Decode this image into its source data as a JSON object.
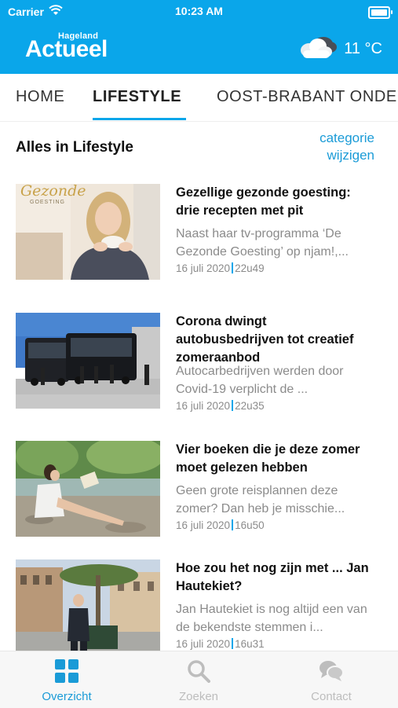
{
  "status_bar": {
    "carrier": "Carrier",
    "time": "10:23 AM"
  },
  "header": {
    "logo_superscript": "Hageland",
    "logo_main": "Actueel",
    "weather_icon": "cloud-icon",
    "temperature": "11 °C"
  },
  "tabs": [
    {
      "label": "HOME",
      "active": false
    },
    {
      "label": "LIFESTYLE",
      "active": true
    },
    {
      "label": "OOST-BRABANT ONDERNEMEN",
      "active": false
    }
  ],
  "section": {
    "title": "Alles in Lifestyle",
    "change_link_line1": "categorie",
    "change_link_line2": "wijzigen"
  },
  "articles": [
    {
      "title": "Gezellige gezonde goesting: drie recepten met pit",
      "excerpt": "Naast haar tv-programma ‘De Gezonde Goesting’ op njam!,...",
      "date": "16 juli 2020",
      "time": "22u49",
      "thumb_text_1": "Gezonde",
      "thumb_text_2": "GOESTING"
    },
    {
      "title": "Corona dwingt autobusbedrijven tot creatief zomeraanbod",
      "excerpt": "Autocarbedrijven werden door Covid-19 verplicht de ...",
      "date": "16 juli 2020",
      "time": "22u35"
    },
    {
      "title": "Vier boeken die je deze zomer moet gelezen hebben",
      "excerpt": "Geen grote reisplannen deze zomer? Dan heb je misschie...",
      "date": "16 juli 2020",
      "time": "16u50"
    },
    {
      "title": "Hoe zou het nog zijn met ... Jan Hautekiet?",
      "excerpt": "Jan Hautekiet is nog altijd een van de bekendste stemmen i...",
      "date": "16 juli 2020",
      "time": "16u31"
    }
  ],
  "tabbar": [
    {
      "label": "Overzicht",
      "icon": "grid-icon",
      "active": true
    },
    {
      "label": "Zoeken",
      "icon": "search-icon",
      "active": false
    },
    {
      "label": "Contact",
      "icon": "chat-icon",
      "active": false
    }
  ],
  "colors": {
    "brand_blue": "#0aa6ea",
    "link_blue": "#1a9bd7",
    "muted_text": "#8b8b8b"
  }
}
